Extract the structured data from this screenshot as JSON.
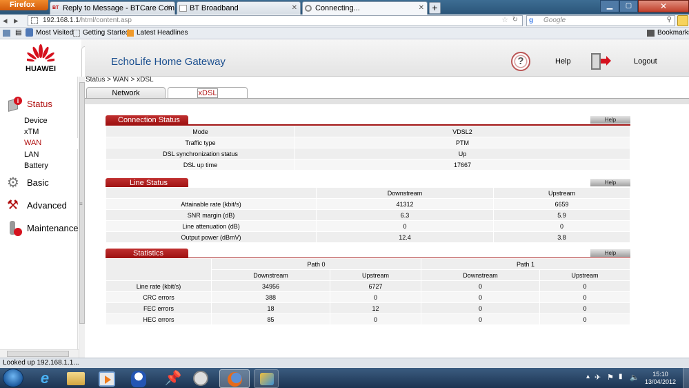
{
  "browser": {
    "menu_button": "Firefox",
    "tabs": [
      {
        "label": "Reply to Message - BTCare Communi...",
        "favicon": "BT"
      },
      {
        "label": "BT Broadband",
        "favicon": "page"
      },
      {
        "label": "Connecting...",
        "favicon": "loading"
      }
    ],
    "new_tab": "+",
    "url_host": "192.168.1.1",
    "url_path": "/html/content.asp",
    "search_placeholder": "Google",
    "bookmarks": [
      "Most Visited",
      "Getting Started",
      "Latest Headlines"
    ],
    "bookmarks_menu": "Bookmarks",
    "status_text": "Looked up 192.168.1.1..."
  },
  "router": {
    "brand": "HUAWEI",
    "title": "EchoLife Home Gateway",
    "help": "Help",
    "logout": "Logout",
    "breadcrumb": "Status > WAN > xDSL",
    "subtabs": [
      "Network",
      "xDSL"
    ],
    "nav": {
      "status": "Status",
      "status_items": [
        "Device",
        "xTM",
        "WAN",
        "LAN",
        "Battery"
      ],
      "basic": "Basic",
      "advanced": "Advanced",
      "maintenance": "Maintenance"
    },
    "help_button": "Help",
    "connection_status": {
      "title": "Connection Status",
      "rows": [
        [
          "Mode",
          "VDSL2"
        ],
        [
          "Traffic type",
          "PTM"
        ],
        [
          "DSL synchronization status",
          "Up"
        ],
        [
          "DSL up time",
          "17667"
        ]
      ]
    },
    "line_status": {
      "title": "Line Status",
      "headers": [
        "",
        "Downstream",
        "Upstream"
      ],
      "rows": [
        [
          "Attainable rate (kbit/s)",
          "41312",
          "6659"
        ],
        [
          "SNR margin (dB)",
          "6.3",
          "5.9"
        ],
        [
          "Line attenuation (dB)",
          "0",
          "0"
        ],
        [
          "Output power (dBmV)",
          "12.4",
          "3.8"
        ]
      ]
    },
    "statistics": {
      "title": "Statistics",
      "groups": [
        "Path 0",
        "Path 1"
      ],
      "subheaders": [
        "Downstream",
        "Upstream",
        "Downstream",
        "Upstream"
      ],
      "rows": [
        [
          "Line rate (kbit/s)",
          "34956",
          "6727",
          "0",
          "0"
        ],
        [
          "CRC errors",
          "388",
          "0",
          "0",
          "0"
        ],
        [
          "FEC errors",
          "18",
          "12",
          "0",
          "0"
        ],
        [
          "HEC errors",
          "85",
          "0",
          "0",
          "0"
        ]
      ]
    }
  },
  "taskbar": {
    "time": "15:10",
    "date": "13/04/2012"
  },
  "colors": {
    "accent_red": "#a01414",
    "title_blue": "#1b4f8f"
  }
}
